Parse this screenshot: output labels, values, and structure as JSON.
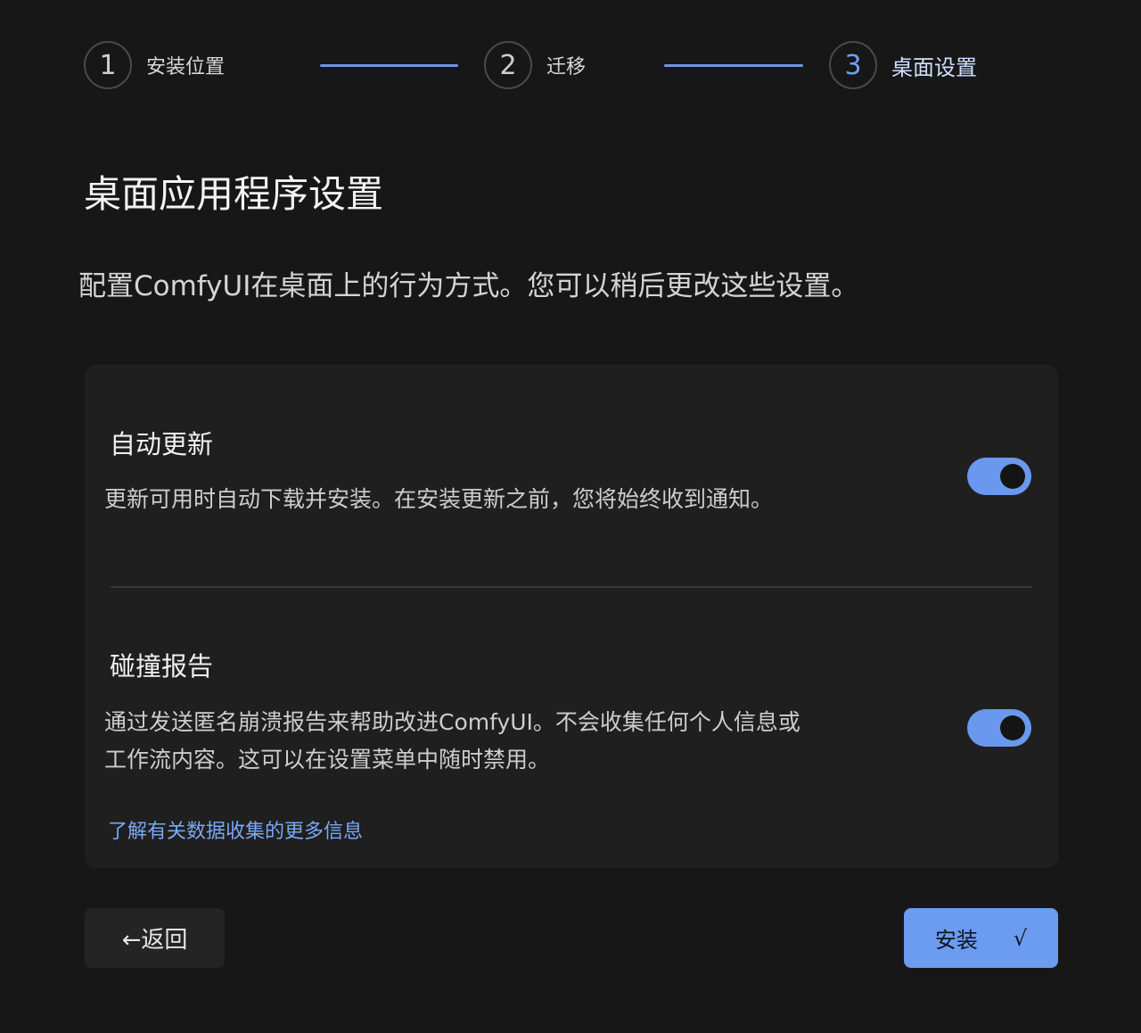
{
  "stepper": {
    "steps": [
      {
        "number": "1",
        "label": "安装位置"
      },
      {
        "number": "2",
        "label": "迁移"
      },
      {
        "number": "3",
        "label": "桌面设置"
      }
    ]
  },
  "page": {
    "title": "桌面应用程序设置",
    "description": "配置ComfyUI在桌面上的行为方式。您可以稍后更改这些设置。"
  },
  "settings": {
    "auto_update": {
      "title": "自动更新",
      "description": "更新可用时自动下载并安装。在安装更新之前，您将始终收到通知。",
      "enabled": true
    },
    "crash_report": {
      "title": "碰撞报告",
      "description_line1": "通过发送匿名崩溃报告来帮助改进ComfyUI。不会收集任何个人信息或",
      "description_line2": "工作流内容。这可以在设置菜单中随时禁用。",
      "enabled": true
    },
    "learn_more_link": "了解有关数据收集的更多信息"
  },
  "footer": {
    "back_label": "←返回",
    "install_label": "安装",
    "install_icon_glyph": "√"
  },
  "colors": {
    "accent": "#6b9cf1",
    "background": "#171717",
    "card": "#1f1f1f"
  }
}
